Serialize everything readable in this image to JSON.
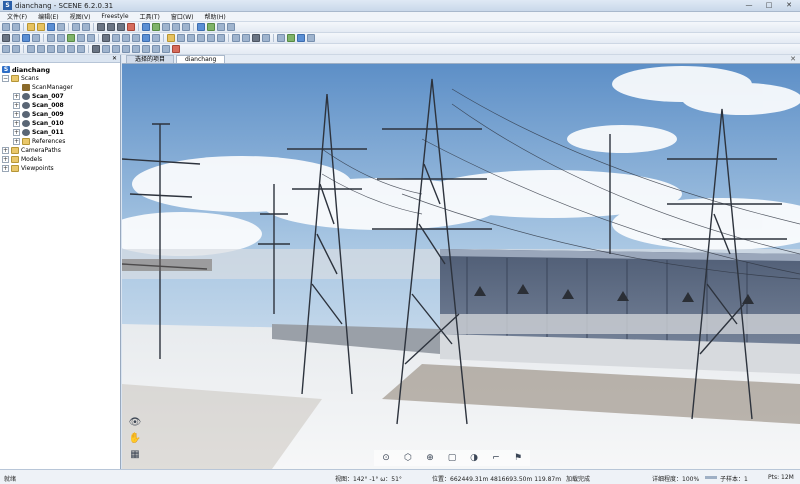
{
  "window": {
    "title": "dianchang - SCENE 6.2.0.31",
    "app_icon": "S",
    "minimize": "—",
    "maximize": "□",
    "close": "✕"
  },
  "menu": [
    "文件(F)",
    "编辑(E)",
    "视图(V)",
    "Freestyle",
    "工具(T)",
    "窗口(W)",
    "帮助(H)"
  ],
  "structure": {
    "close": "✕",
    "items": [
      {
        "label": "dianchang",
        "icon": "workspace-icon",
        "level": 0,
        "expander": ""
      },
      {
        "label": "Scans",
        "icon": "folder-icon",
        "level": 0,
        "expander": "−"
      },
      {
        "label": "ScanManager",
        "icon": "scan-manager-icon",
        "level": 1,
        "expander": ""
      },
      {
        "label": "Scan_007",
        "icon": "scan-icon",
        "level": 1,
        "expander": "+"
      },
      {
        "label": "Scan_008",
        "icon": "scan-icon",
        "level": 1,
        "expander": "+"
      },
      {
        "label": "Scan_009",
        "icon": "scan-icon",
        "level": 1,
        "expander": "+"
      },
      {
        "label": "Scan_010",
        "icon": "scan-icon",
        "level": 1,
        "expander": "+"
      },
      {
        "label": "Scan_011",
        "icon": "scan-icon",
        "level": 1,
        "expander": "+"
      },
      {
        "label": "References",
        "icon": "folder-icon",
        "level": 1,
        "expander": "+"
      },
      {
        "label": "CameraPaths",
        "icon": "folder-icon",
        "level": 0,
        "expander": "+"
      },
      {
        "label": "Models",
        "icon": "folder-icon",
        "level": 0,
        "expander": "+"
      },
      {
        "label": "Viewpoints",
        "icon": "folder-icon",
        "level": 0,
        "expander": "+"
      }
    ]
  },
  "tabs": [
    {
      "label": "选择的项目",
      "active": false
    },
    {
      "label": "dianchang",
      "active": true
    }
  ],
  "tab_close": "✕",
  "status": {
    "left": "就绪",
    "view": "视图：142° -1° ω：51°",
    "position": "位置：662449.31m 4816693.50m 119.87m",
    "load": "加载完成",
    "quality_label": "详细程度：100%",
    "subsample": "子样本：1",
    "points": "Pts: 12M"
  },
  "side_tools": [
    "eye-icon",
    "navigate-icon",
    "grid-icon"
  ],
  "bottom_tools": [
    "orbit-icon",
    "cube-view-icon",
    "zoom-icon",
    "box-view-icon",
    "clip-icon",
    "measure-icon",
    "flag-icon"
  ]
}
